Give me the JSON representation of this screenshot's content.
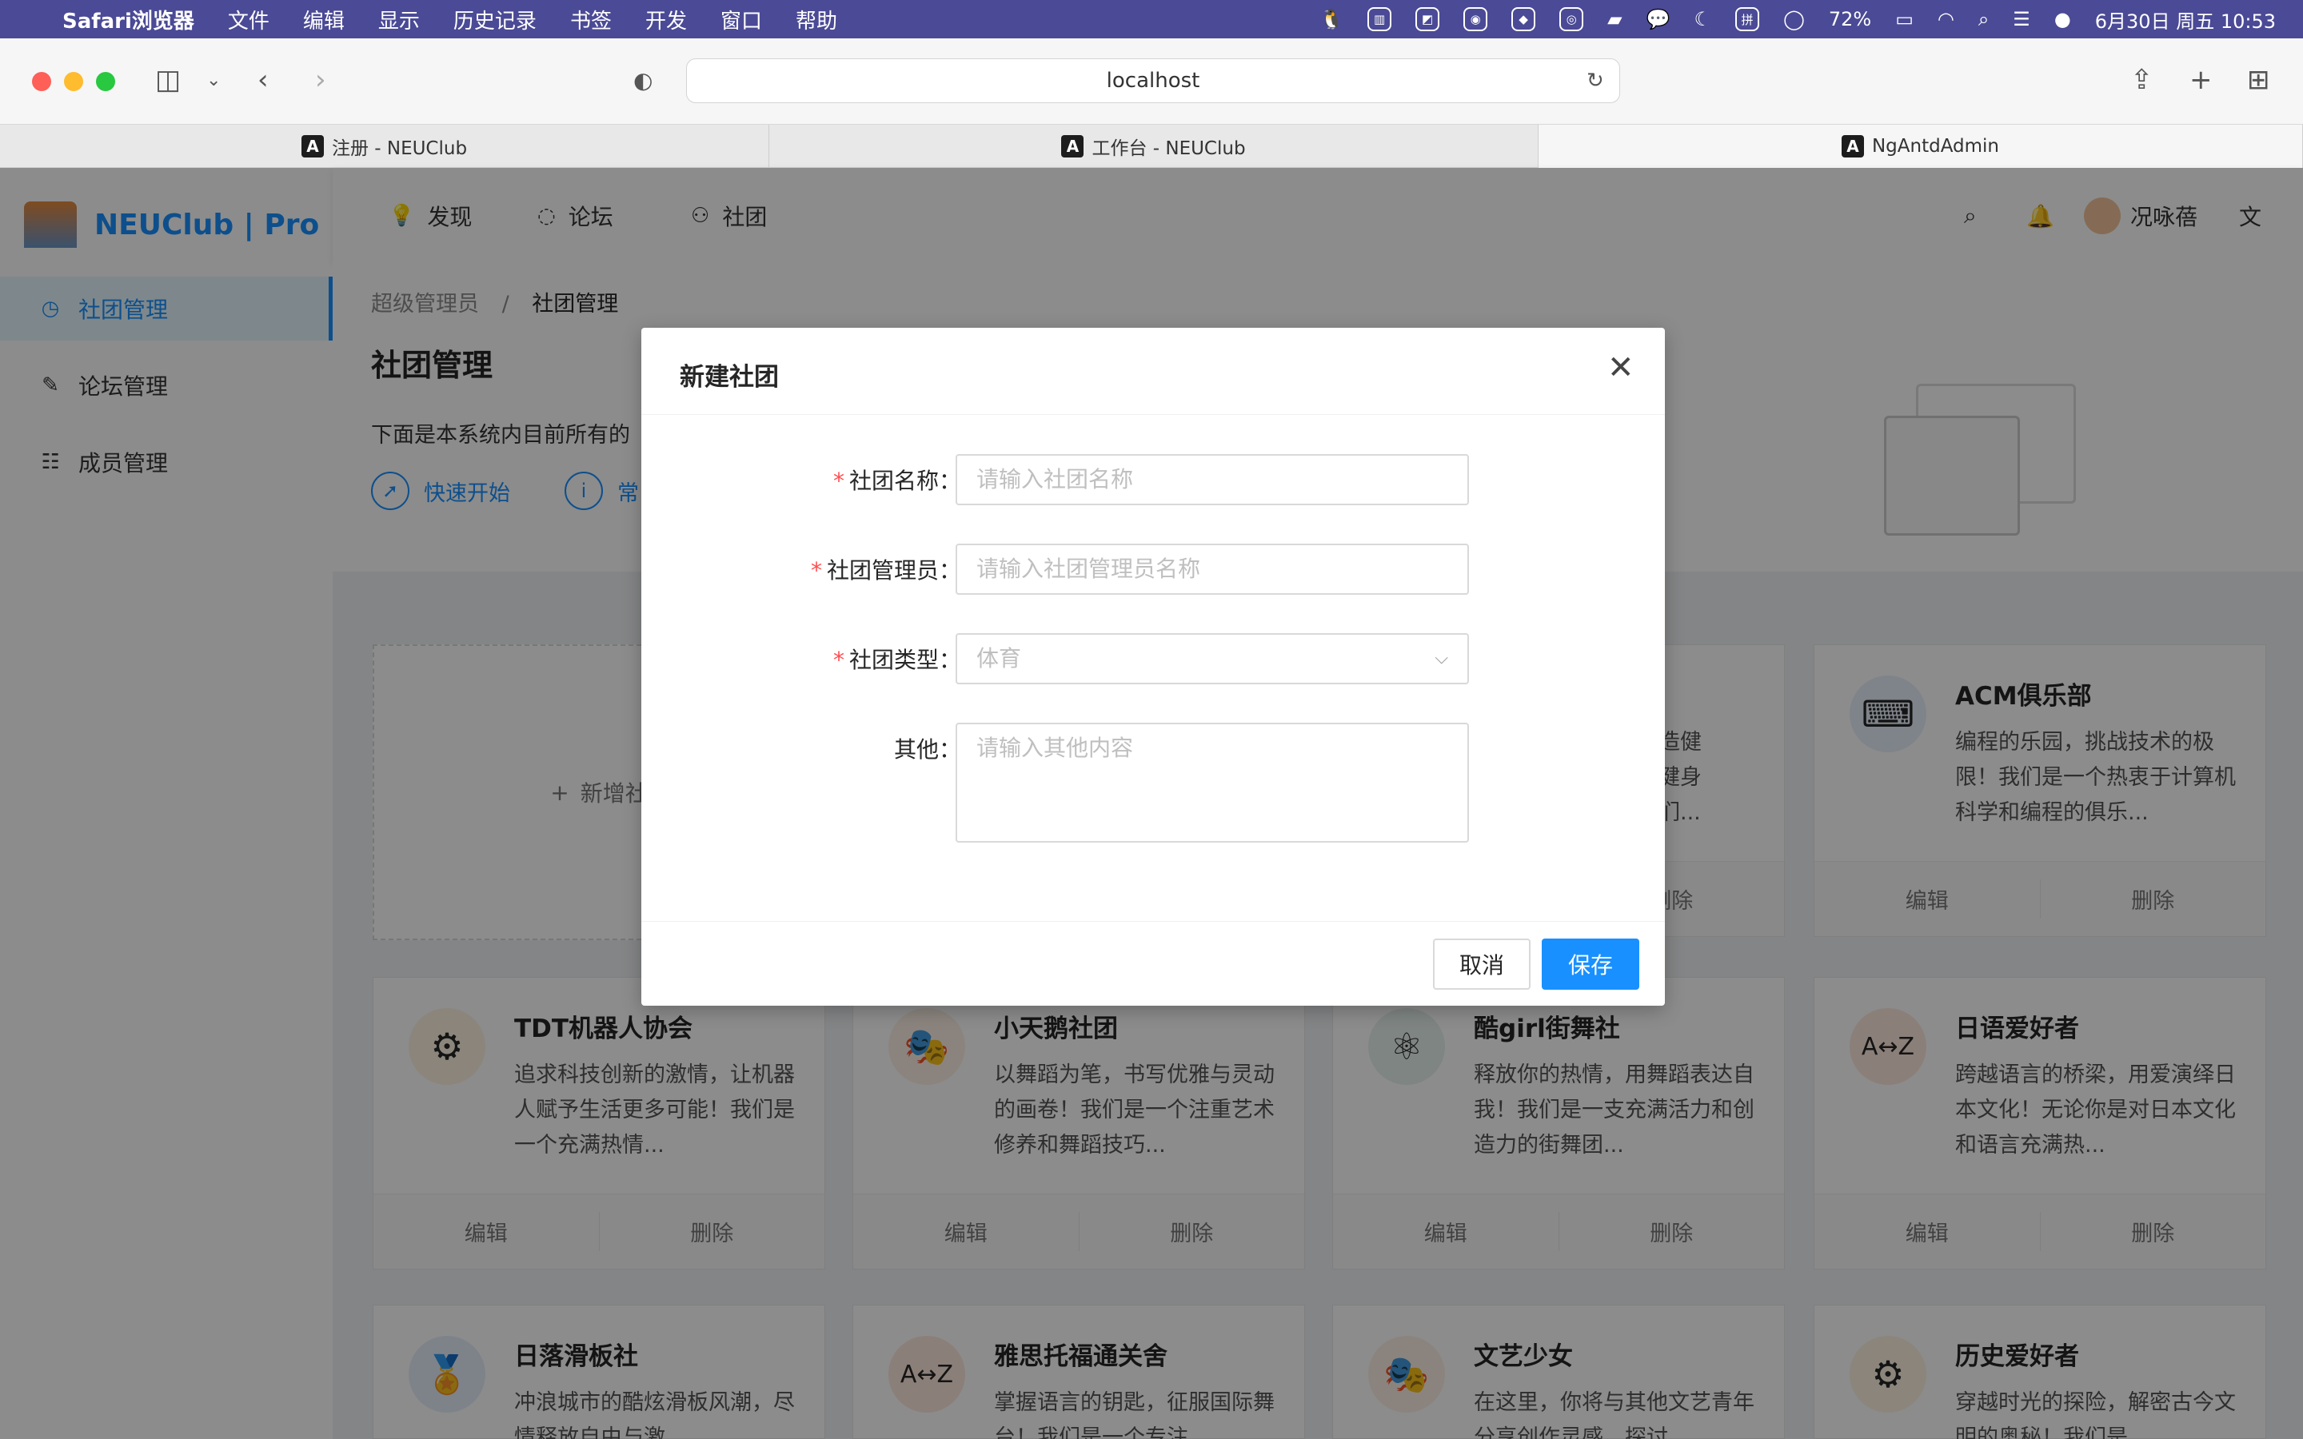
{
  "menubar": {
    "app": "Safari浏览器",
    "items": [
      "文件",
      "编辑",
      "显示",
      "历史记录",
      "书签",
      "开发",
      "窗口",
      "帮助"
    ],
    "battery": "72%",
    "datetime": "6月30日 周五  10:53"
  },
  "browser": {
    "url": "localhost",
    "tabs": [
      {
        "label": "注册 - NEUClub"
      },
      {
        "label": "工作台 - NEUClub"
      },
      {
        "label": "NgAntdAdmin"
      }
    ]
  },
  "app": {
    "brand": "NEUClub | Pro",
    "sider": [
      {
        "label": "社团管理",
        "icon": "dashboard-icon"
      },
      {
        "label": "论坛管理",
        "icon": "edit-icon"
      },
      {
        "label": "成员管理",
        "icon": "list-icon"
      }
    ],
    "nav": [
      {
        "label": "发现",
        "icon": "bulb-icon"
      },
      {
        "label": "论坛",
        "icon": "message-icon"
      },
      {
        "label": "社团",
        "icon": "team-icon"
      }
    ],
    "user": "况咏蓓"
  },
  "page": {
    "breadcrumb": [
      "超级管理员",
      "社团管理"
    ],
    "title": "社团管理",
    "desc": "下面是本系统内目前所有的",
    "links": [
      "快速开始",
      "常"
    ]
  },
  "cards": {
    "add_label": "新增社",
    "edit": "编辑",
    "delete": "删除",
    "items": [
      {
        "name": "",
        "desc": "塑造健\n是健身\n我们..."
      },
      {
        "name": "ACM俱乐部",
        "desc": "编程的乐园，挑战技术的极限！我们是一个热衷于计算机科学和编程的俱乐..."
      },
      {
        "name": "TDT机器人协会",
        "desc": "追求科技创新的激情，让机器人赋予生活更多可能！我们是一个充满热情..."
      },
      {
        "name": "小天鹅社团",
        "desc": "以舞蹈为笔，书写优雅与灵动的画卷！我们是一个注重艺术修养和舞蹈技巧..."
      },
      {
        "name": "酷girl街舞社",
        "desc": "释放你的热情，用舞蹈表达自我！我们是一支充满活力和创造力的街舞团..."
      },
      {
        "name": "日语爱好者",
        "desc": "跨越语言的桥梁，用爱演绎日本文化！无论你是对日本文化和语言充满热..."
      },
      {
        "name": "日落滑板社",
        "desc": "冲浪城市的酷炫滑板风潮，尽情释放自由与激"
      },
      {
        "name": "雅思托福通关舍",
        "desc": "掌握语言的钥匙，征服国际舞台！我们是一个专注"
      },
      {
        "name": "文艺少女",
        "desc": "在这里，你将与其他文艺青年分享创作灵感，探讨"
      },
      {
        "name": "历史爱好者",
        "desc": "穿越时光的探险，解密古今文明的奥秘！我们是"
      }
    ]
  },
  "modal": {
    "title": "新建社团",
    "fields": {
      "name_label": "社团名称",
      "name_ph": "请输入社团名称",
      "admin_label": "社团管理员",
      "admin_ph": "请输入社团管理员名称",
      "type_label": "社团类型",
      "type_value": "体育",
      "other_label": "其他",
      "other_ph": "请输入其他内容"
    },
    "cancel": "取消",
    "save": "保存"
  },
  "colors": {
    "primary": "#1890ff",
    "menubar": "#4b4a96",
    "required": "#ff4d4f"
  }
}
